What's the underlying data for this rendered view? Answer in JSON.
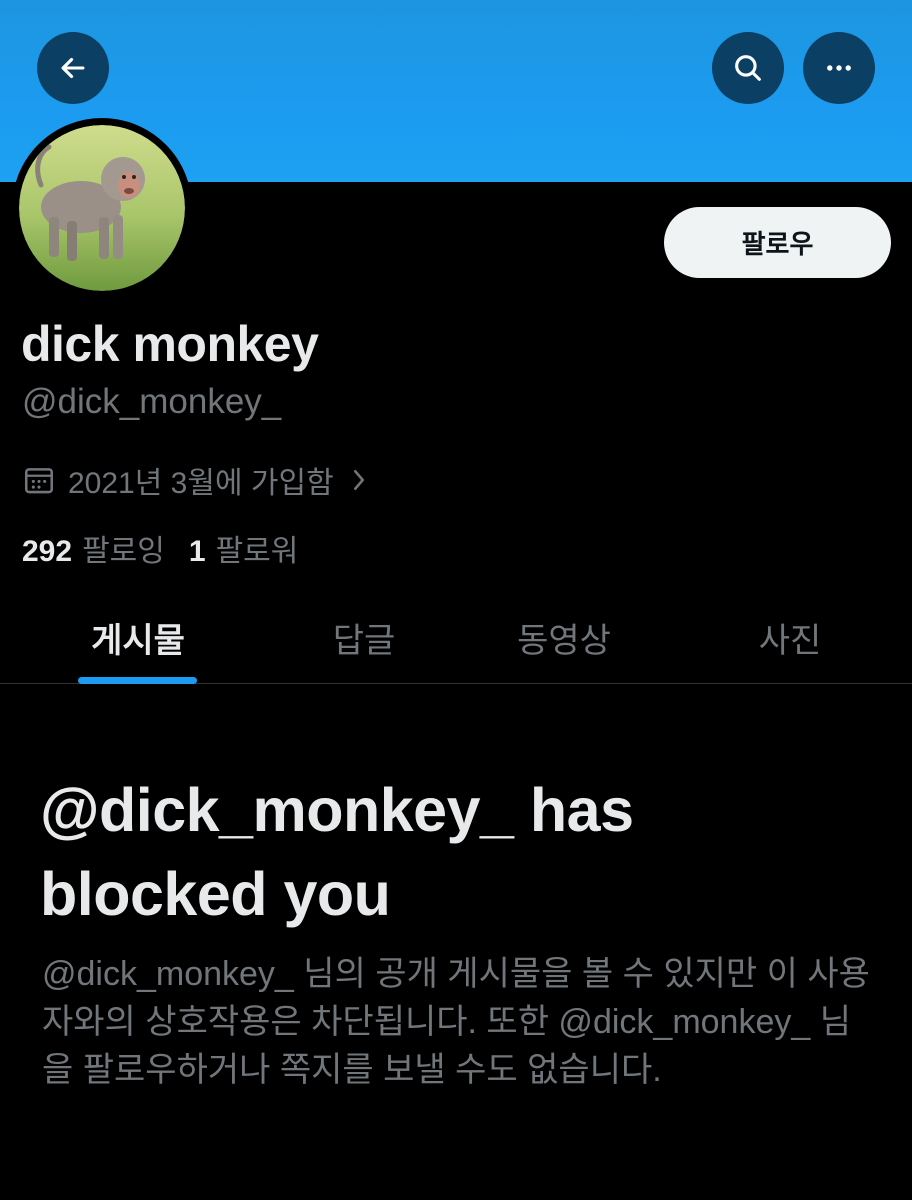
{
  "profile": {
    "display_name": "dick monkey",
    "handle": "@dick_monkey_",
    "joined": "2021년 3월에 가입함",
    "follow_label": "팔로우"
  },
  "stats": {
    "following_count": "292",
    "following_label": "팔로잉",
    "followers_count": "1",
    "followers_label": "팔로워"
  },
  "tabs": [
    {
      "label": "게시물"
    },
    {
      "label": "답글"
    },
    {
      "label": "동영상"
    },
    {
      "label": "사진"
    }
  ],
  "blocked": {
    "title": "@dick_monkey_ has blocked you",
    "description": "@dick_monkey_ 님의 공개 게시물을 볼 수 있지만 이 사용자와의 상호작용은 차단됩니다. 또한 @dick_monkey_ 님을 팔로우하거나 쪽지를 보낼 수도 없습니다."
  },
  "icons": {
    "back": "arrow-left-icon",
    "search": "search-icon",
    "more": "more-horizontal-icon",
    "calendar": "calendar-icon",
    "chevron": "chevron-right-icon"
  },
  "colors": {
    "banner": "#1d9bf0",
    "accent": "#1d9bf0",
    "background": "#000000",
    "muted_text": "#71767b",
    "follow_button_bg": "#eff3f4"
  }
}
